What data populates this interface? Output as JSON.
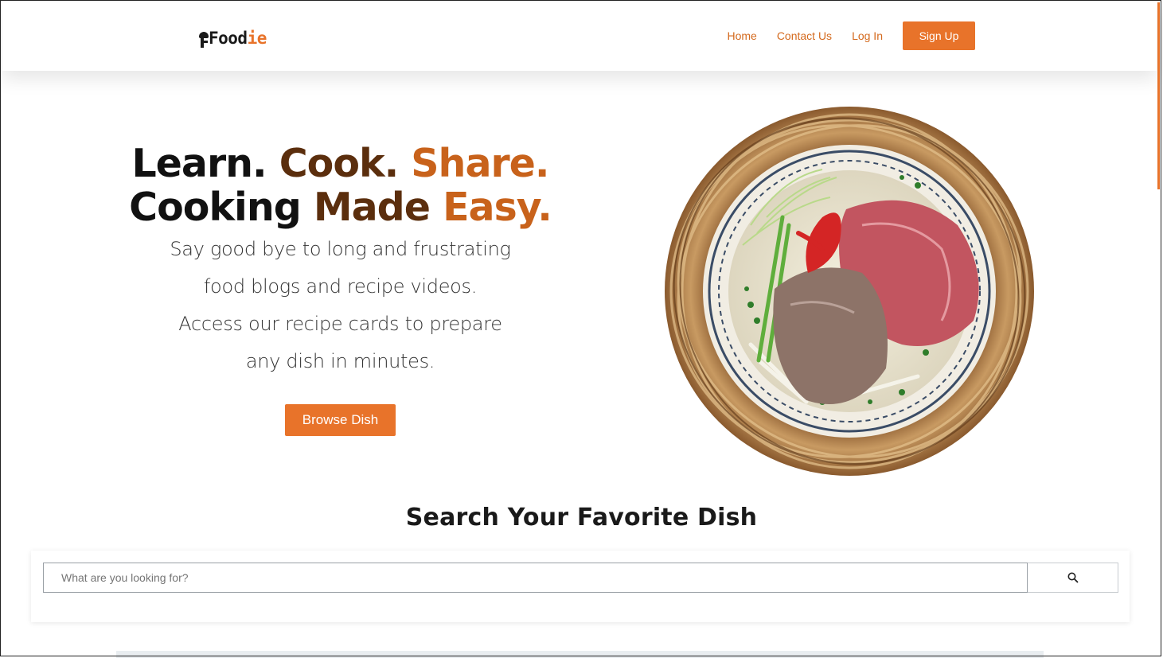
{
  "brand": {
    "name_main": "Food",
    "name_accent": "ie",
    "logo_icon": "chef-hat-icon"
  },
  "nav": {
    "links": [
      "Home",
      "Contact Us",
      "Log In"
    ],
    "signup_label": "Sign Up"
  },
  "hero": {
    "line1": {
      "learn": "Learn.",
      "cook": "Cook.",
      "share": "Share."
    },
    "line2": {
      "cooking": "Cooking",
      "made": "Made",
      "easy": "Easy."
    },
    "subtext": "Say good bye to long and frustrating food blogs and recipe videos. Access our recipe cards to prepare any dish in minutes.",
    "cta_label": "Browse Dish",
    "image": "pho-bowl-in-woven-basket"
  },
  "search": {
    "title": "Search Your Favorite Dish",
    "placeholder": "What are you looking for?",
    "button_icon": "search-icon"
  },
  "colors": {
    "accent": "#e8732a",
    "accent_text": "#d46a1e",
    "brown_dark": "#5b2e0d",
    "brown_orange": "#c8621b"
  }
}
